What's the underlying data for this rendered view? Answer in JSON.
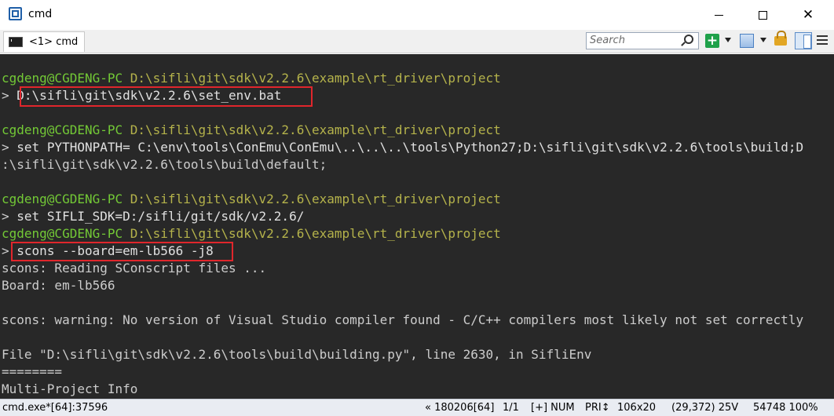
{
  "window": {
    "title": "cmd",
    "minimize_label": "",
    "maximize_label": "",
    "close_label": "✕"
  },
  "tabbar": {
    "tab_label": "<1> cmd",
    "search_placeholder": "Search"
  },
  "console": {
    "lines": [
      {
        "user": "cgdeng@CGDENG-PC",
        "path": "D:\\sifli\\git\\sdk\\v2.2.6\\example\\rt_driver\\project"
      },
      {
        "prompt": ">",
        "cmd": "D:\\sifli\\git\\sdk\\v2.2.6\\set_env.bat"
      },
      {
        "blank": ""
      },
      {
        "user": "cgdeng@CGDENG-PC",
        "path": "D:\\sifli\\git\\sdk\\v2.2.6\\example\\rt_driver\\project"
      },
      {
        "prompt": ">",
        "cmd": "set PYTHONPATH= C:\\env\\tools\\ConEmu\\ConEmu\\..\\..\\..\\tools\\Python27;D:\\sifli\\git\\sdk\\v2.2.6\\tools\\build;D"
      },
      {
        "text": ":\\sifli\\git\\sdk\\v2.2.6\\tools\\build\\default;"
      },
      {
        "blank": ""
      },
      {
        "user": "cgdeng@CGDENG-PC",
        "path": "D:\\sifli\\git\\sdk\\v2.2.6\\example\\rt_driver\\project"
      },
      {
        "prompt": ">",
        "cmd": "set SIFLI_SDK=D:/sifli/git/sdk/v2.2.6/"
      },
      {
        "user": "cgdeng@CGDENG-PC",
        "path": "D:\\sifli\\git\\sdk\\v2.2.6\\example\\rt_driver\\project"
      },
      {
        "prompt": ">",
        "cmd": "scons --board=em-lb566 -j8"
      },
      {
        "text": "scons: Reading SConscript files ..."
      },
      {
        "text": "Board: em-lb566"
      },
      {
        "blank": ""
      },
      {
        "text": "scons: warning: No version of Visual Studio compiler found - C/C++ compilers most likely not set correctly"
      },
      {
        "blank": ""
      },
      {
        "text": "File \"D:\\sifli\\git\\sdk\\v2.2.6\\tools\\build\\building.py\", line 2630, in SifliEnv"
      },
      {
        "text": "========"
      },
      {
        "text": "Multi-Project Info"
      }
    ]
  },
  "statusbar": {
    "process": "cmd.exe*[64]:37596",
    "position": "« 180206[64]",
    "page": "1/1",
    "num": "[+] NUM",
    "pri": "PRI↕",
    "size": "106x20",
    "coords": "(29,372) 25V",
    "mem": "54748 100%"
  },
  "colors": {
    "console_bg": "#282828",
    "prompt_green": "#73c936",
    "highlight_red": "#e0262c"
  }
}
